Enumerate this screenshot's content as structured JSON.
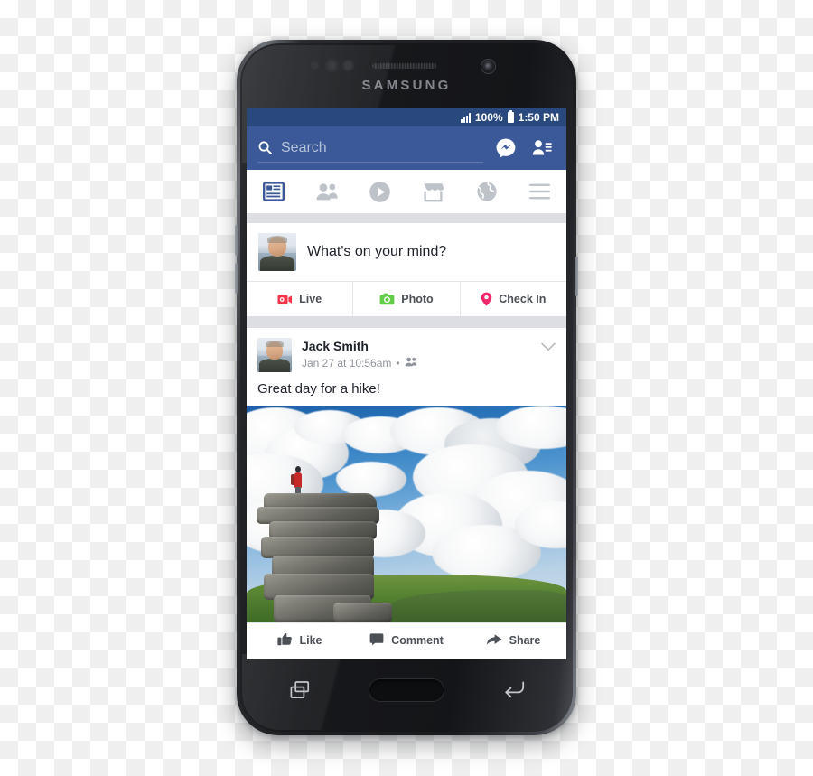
{
  "device": {
    "brand": "SAMSUNG",
    "hardware_keys": {
      "recents": "recent-apps-key",
      "home": "home-key",
      "back": "back-key"
    }
  },
  "statusbar": {
    "signal_icon": "signal-bars-icon",
    "battery_percent": "100%",
    "battery_icon": "battery-full-icon",
    "time": "1:50 PM"
  },
  "topbar": {
    "search_icon": "search-icon",
    "search_placeholder": "Search",
    "search_value": "",
    "messenger_icon": "messenger-icon",
    "friend_requests_icon": "friend-requests-icon"
  },
  "tabs": [
    {
      "name": "news-feed",
      "icon": "news-feed-icon",
      "active": true
    },
    {
      "name": "friends",
      "icon": "friends-icon",
      "active": false
    },
    {
      "name": "watch",
      "icon": "play-video-icon",
      "active": false
    },
    {
      "name": "marketplace",
      "icon": "marketplace-store-icon",
      "active": false
    },
    {
      "name": "notifications",
      "icon": "globe-notifications-icon",
      "active": false
    },
    {
      "name": "menu",
      "icon": "hamburger-menu-icon",
      "active": false
    }
  ],
  "composer": {
    "avatar": "user-avatar",
    "prompt": "What's on your mind?",
    "actions": [
      {
        "label": "Live",
        "icon": "live-video-icon",
        "color": "#f5354a"
      },
      {
        "label": "Photo",
        "icon": "photo-camera-icon",
        "color": "#63cc4b"
      },
      {
        "label": "Check In",
        "icon": "location-pin-icon",
        "color": "#f5276b"
      }
    ]
  },
  "post": {
    "avatar": "author-avatar",
    "author": "Jack Smith",
    "timestamp": "Jan 27 at 10:56am",
    "separator": "•",
    "audience_icon": "friends-audience-icon",
    "options_icon": "chevron-down-icon",
    "text": "Great day for a hike!",
    "photo": {
      "alt": "hiker-on-rock-tor-photo"
    },
    "actions": [
      {
        "label": "Like",
        "icon": "thumbs-up-icon"
      },
      {
        "label": "Comment",
        "icon": "comment-bubble-icon"
      },
      {
        "label": "Share",
        "icon": "share-arrow-icon"
      }
    ]
  },
  "colors": {
    "fb_blue": "#3b5998",
    "status_blue": "#29487d",
    "feed_gray": "#dcdee3",
    "text_dark": "#1d2129",
    "text_muted": "#90949c"
  }
}
